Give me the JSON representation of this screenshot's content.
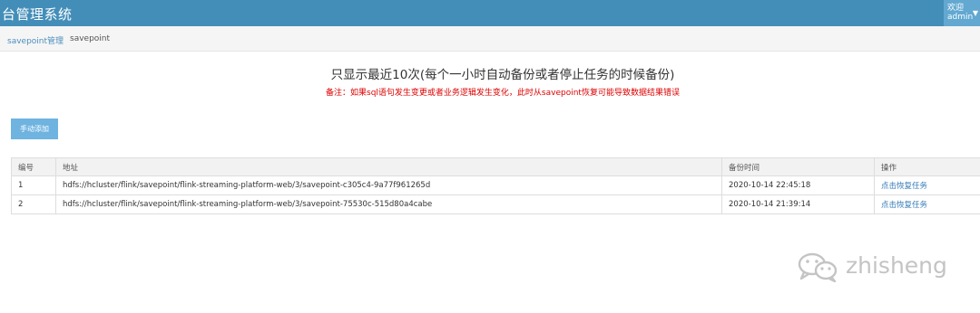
{
  "header": {
    "brand": "台管理系统",
    "welcome": "欢迎",
    "username": "admin"
  },
  "breadcrumb": {
    "parent": "savepoint管理",
    "current": "savepoint"
  },
  "notice": {
    "title": "只显示最近10次(每个一小时自动备份或者停止任务的时候备份)",
    "warning": "备注：如果sql语句发生变更或者业务逻辑发生变化，此时从savepoint恢复可能导致数据结果错误"
  },
  "toolbar": {
    "add_label": "手动添加"
  },
  "table": {
    "headers": [
      "编号",
      "地址",
      "备份时间",
      "操作"
    ],
    "rows": [
      {
        "id": "1",
        "path": "hdfs://hcluster/flink/savepoint/flink-streaming-platform-web/3/savepoint-c305c4-9a77f961265d",
        "time": "2020-10-14 22:45:18",
        "action": "点击恢复任务"
      },
      {
        "id": "2",
        "path": "hdfs://hcluster/flink/savepoint/flink-streaming-platform-web/3/savepoint-75530c-515d80a4cabe",
        "time": "2020-10-14 21:39:14",
        "action": "点击恢复任务"
      }
    ]
  },
  "watermark": {
    "text": "zhisheng",
    "icon": "wechat-icon"
  },
  "colors": {
    "navbar": "#438eb9",
    "user_menu": "#62a8d1",
    "button": "#6fb3e0",
    "warning": "#dd0000",
    "link": "#337ab7"
  }
}
